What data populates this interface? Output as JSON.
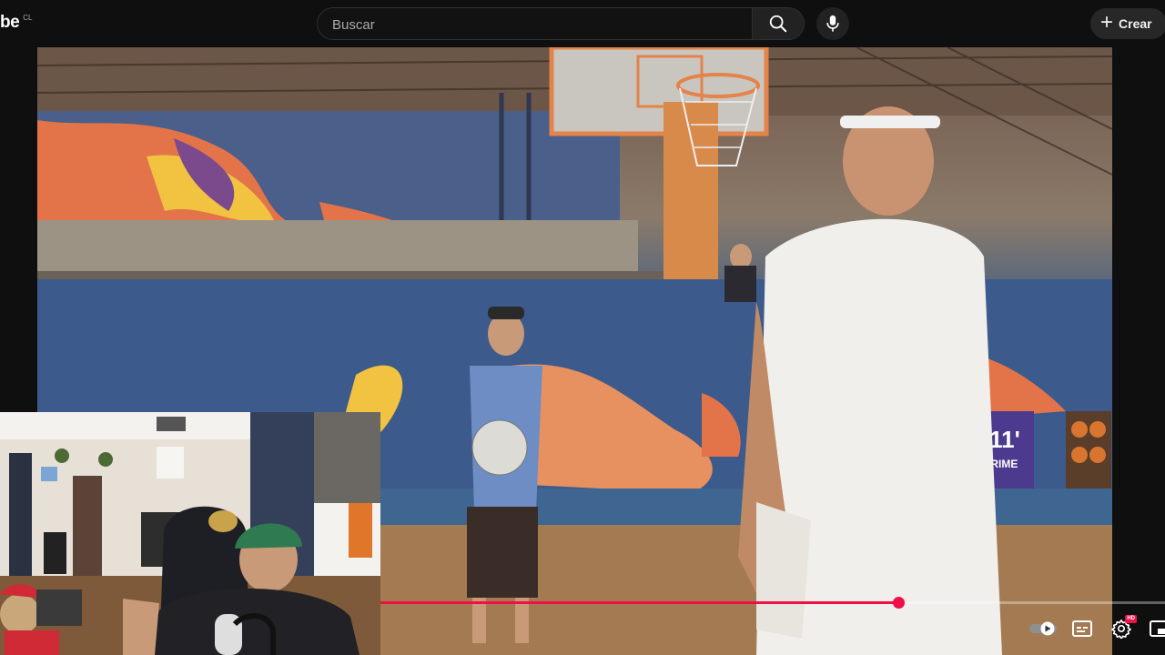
{
  "header": {
    "logo_text": "be",
    "country_code": "CL",
    "search_placeholder": "Buscar",
    "create_label": "Crear"
  },
  "video": {
    "scene_text": {
      "banner_line1": "ER11'",
      "banner_line2": "RTS PRIME"
    }
  },
  "player": {
    "progress_fraction": 0.66,
    "quality_badge": "HD"
  },
  "colors": {
    "accent": "#f00f47",
    "background": "#0f0f0f"
  },
  "icons": [
    "search-icon",
    "mic-icon",
    "plus-icon",
    "autoplay-toggle-icon",
    "subtitles-icon",
    "settings-icon",
    "miniplayer-icon"
  ]
}
